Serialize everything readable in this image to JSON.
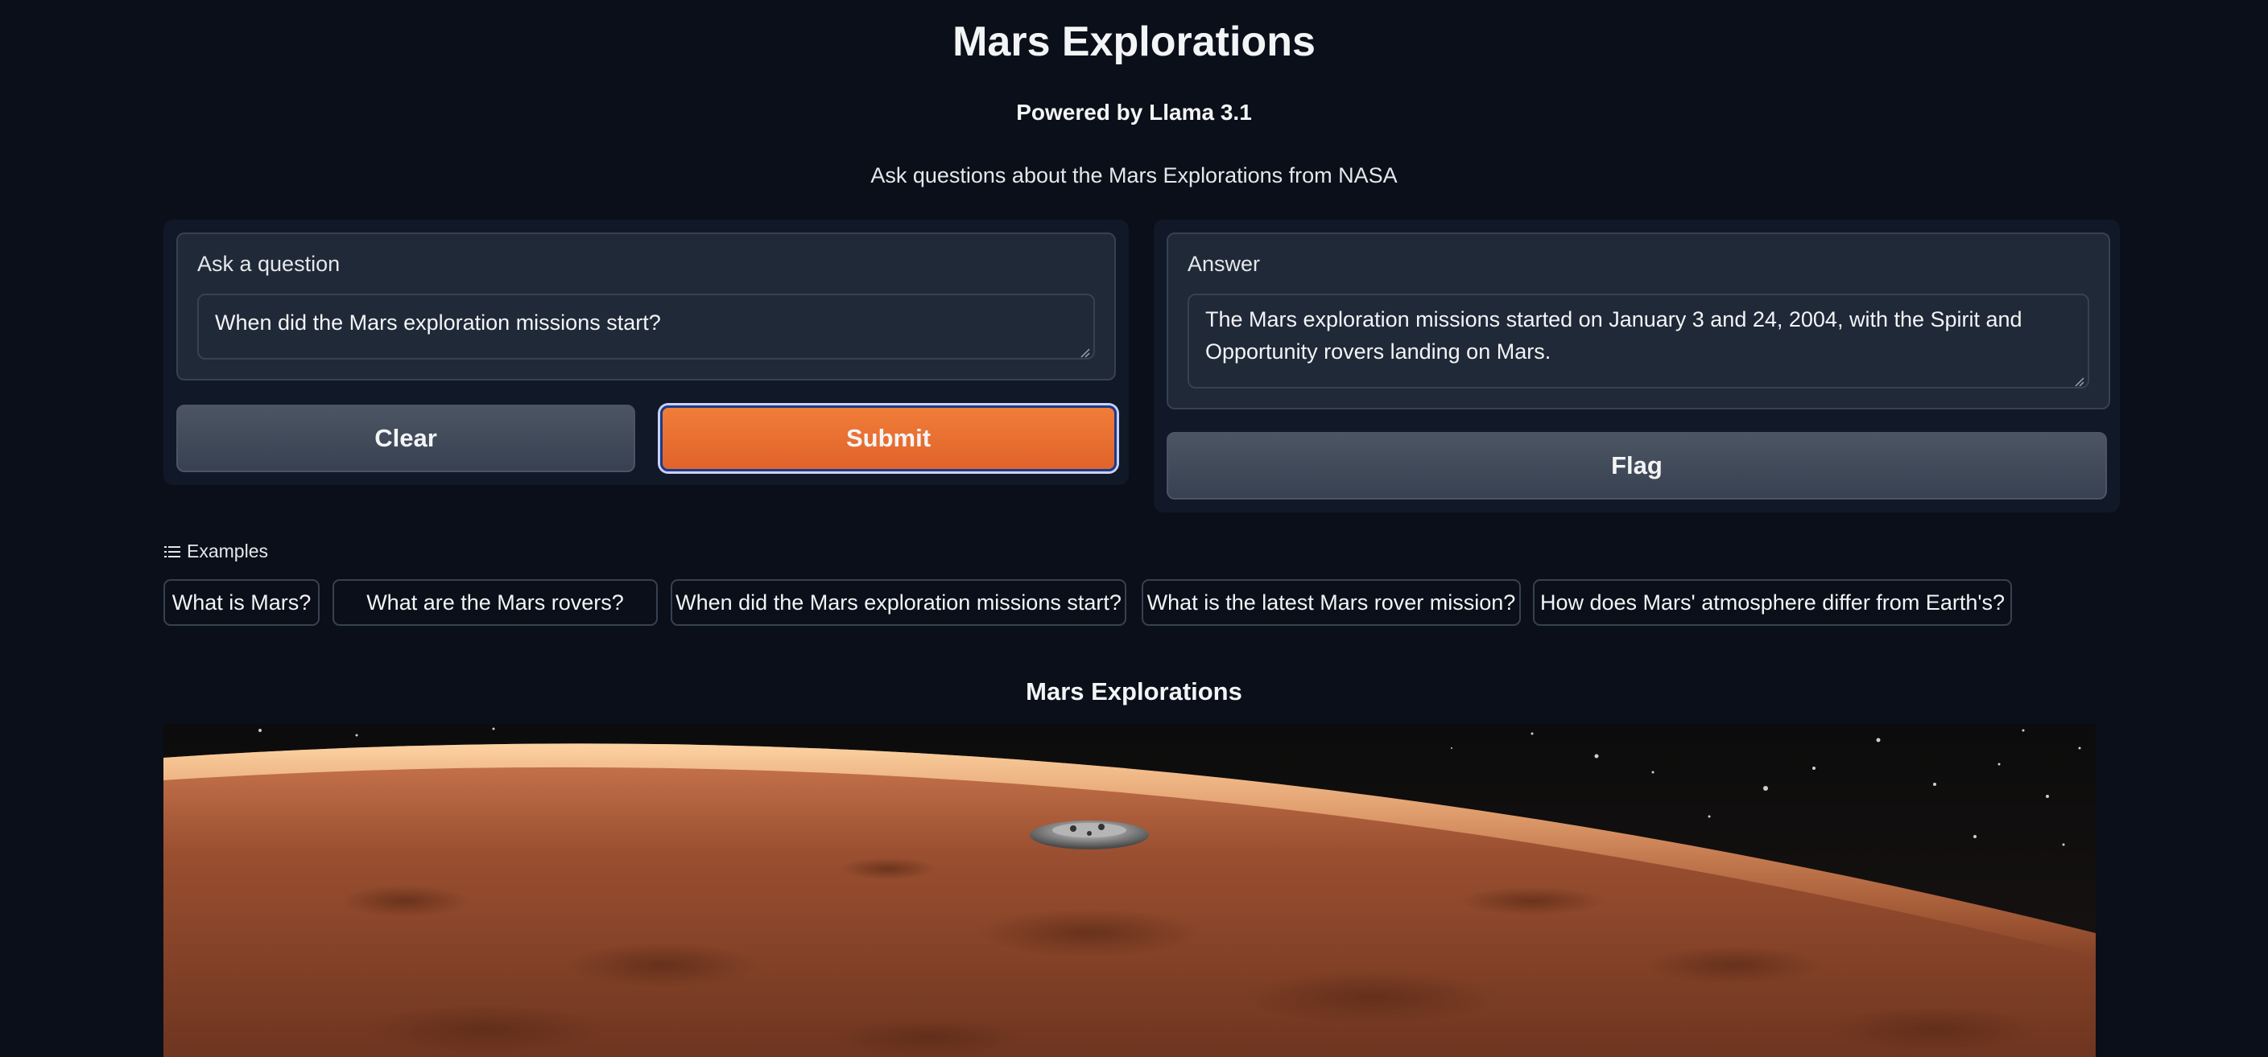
{
  "header": {
    "title": "Mars Explorations",
    "subtitle": "Powered by Llama 3.1",
    "description": "Ask questions about the Mars Explorations from NASA"
  },
  "input_panel": {
    "label": "Ask a question",
    "value": "When did the Mars exploration missions start?",
    "clear_label": "Clear",
    "submit_label": "Submit"
  },
  "output_panel": {
    "label": "Answer",
    "value": "The Mars exploration missions started on January 3 and 24, 2004, with the Spirit and Opportunity rovers landing on Mars.",
    "flag_label": "Flag"
  },
  "examples": {
    "header": "Examples",
    "items": [
      "What is Mars?",
      "What are the Mars rovers?",
      "When did the Mars exploration missions start?",
      "What is the latest Mars rover mission?",
      "How does Mars' atmosphere differ from Earth's?"
    ]
  },
  "image_section": {
    "title": "Mars Explorations"
  },
  "colors": {
    "background": "#0b0f19",
    "panel": "#111827",
    "primary_button": "#e8702f",
    "secondary_button": "#4b5563"
  }
}
